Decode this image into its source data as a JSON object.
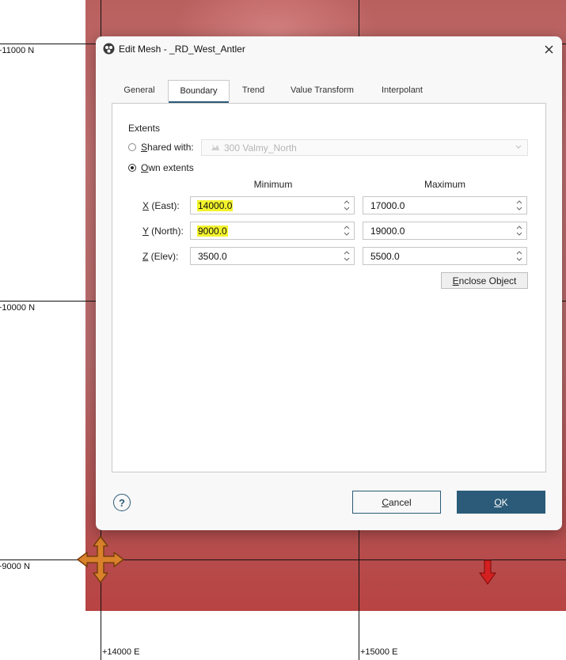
{
  "dialog": {
    "title": "Edit Mesh - _RD_West_Antler",
    "tabs": [
      "General",
      "Boundary",
      "Trend",
      "Value Transform",
      "Interpolant"
    ],
    "active_tab": "Boundary",
    "extents": {
      "section_title": "Extents",
      "shared_with_label_pre": "S",
      "shared_with_label_rest": "hared with:",
      "shared_with_value": "300 Valmy_North",
      "own_extents_label_pre": "O",
      "own_extents_label_rest": "wn extents",
      "selected_option": "Own extents",
      "col_min": "Minimum",
      "col_max": "Maximum",
      "rows": [
        {
          "label_pre": "X",
          "label_rest": " (East):",
          "min": "14000.0",
          "max": "17000.0",
          "min_highlighted": true
        },
        {
          "label_pre": "Y",
          "label_rest": " (North):",
          "min": "9000.0",
          "max": "19000.0",
          "min_highlighted": true
        },
        {
          "label_pre": "Z",
          "label_rest": " (Elev):",
          "min": "3500.0",
          "max": "5500.0",
          "min_highlighted": false
        }
      ],
      "enclose_pre": "E",
      "enclose_rest": "nclose Object"
    },
    "help_label": "?",
    "cancel_pre": "C",
    "cancel_rest": "ancel",
    "ok_pre": "O",
    "ok_rest": "K"
  },
  "viewport": {
    "grid_labels": {
      "n11000": "+11000 N",
      "n10000": "+10000 N",
      "n9000": "+9000 N",
      "e14000": "+14000 E",
      "e15000": "+15000 E"
    },
    "colors": {
      "surface": "#b84343",
      "accent": "#2b5b78",
      "highlight": "#f3f32c"
    }
  }
}
